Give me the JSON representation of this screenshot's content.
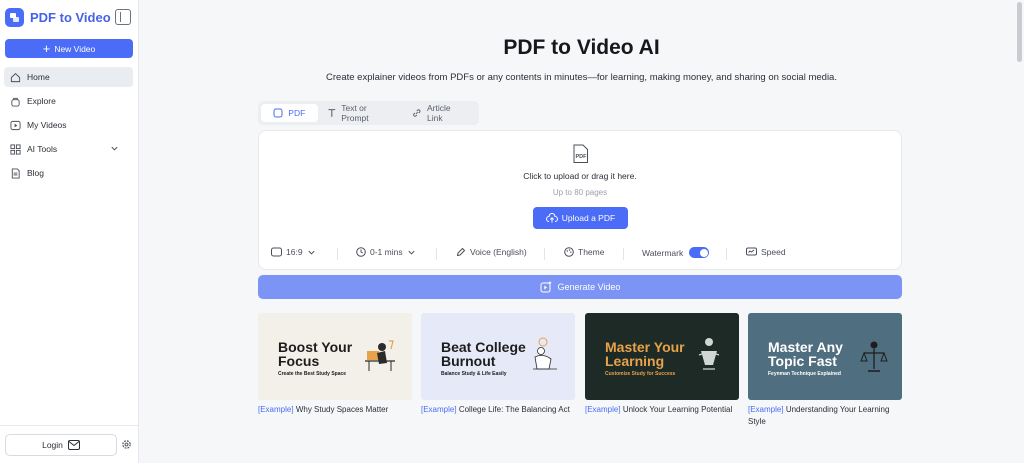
{
  "sidebar": {
    "brand": "PDF to Video",
    "new_video": "New Video",
    "items": [
      {
        "label": "Home",
        "icon": "home-icon"
      },
      {
        "label": "Explore",
        "icon": "explore-icon"
      },
      {
        "label": "My Videos",
        "icon": "play-icon"
      },
      {
        "label": "AI Tools",
        "icon": "grid-icon"
      },
      {
        "label": "Blog",
        "icon": "document-icon"
      }
    ],
    "login": "Login"
  },
  "main": {
    "title": "PDF to Video AI",
    "subtitle": "Create explainer videos from PDFs or any contents in minutes—for learning, making money, and sharing on social media.",
    "tabs": [
      "PDF",
      "Text or Prompt",
      "Article Link"
    ],
    "upload": {
      "hint": "Click to upload or drag it here.",
      "limit": "Up to 80 pages",
      "button": "Upload a PDF"
    },
    "options": {
      "ratio": "16:9",
      "duration": "0-1 mins",
      "voice": "Voice (English)",
      "theme": "Theme",
      "watermark": "Watermark",
      "speed": "Speed"
    },
    "generate": "Generate Video",
    "examples": [
      {
        "heading": "Boost Your Focus",
        "sub": "Create the Best Study Space",
        "tag": "[Example]",
        "caption": "Why Study Spaces Matter",
        "bg": "#f3efe9",
        "fg": "#1d1d1d",
        "subfg": "#1d1d1d"
      },
      {
        "heading": "Beat College Burnout",
        "sub": "Balance Study & Life Easily",
        "tag": "[Example]",
        "caption": "College Life: The Balancing Act",
        "bg": "#e6e9f7",
        "fg": "#1d1d1d",
        "subfg": "#1d1d1d"
      },
      {
        "heading": "Master Your Learning",
        "sub": "Customize Study for Success",
        "tag": "[Example]",
        "caption": "Unlock Your Learning Potential",
        "bg": "#1d2a26",
        "fg": "#e8a24a",
        "subfg": "#e8a24a"
      },
      {
        "heading": "Master Any Topic Fast",
        "sub": "Feynman Technique Explained",
        "tag": "[Example]",
        "caption": "Understanding Your Learning Style",
        "bg": "#4f6e80",
        "fg": "#ffffff",
        "subfg": "#ffffff"
      }
    ]
  },
  "colors": {
    "accent": "#4a6cf7",
    "generate": "#7c94f6"
  }
}
